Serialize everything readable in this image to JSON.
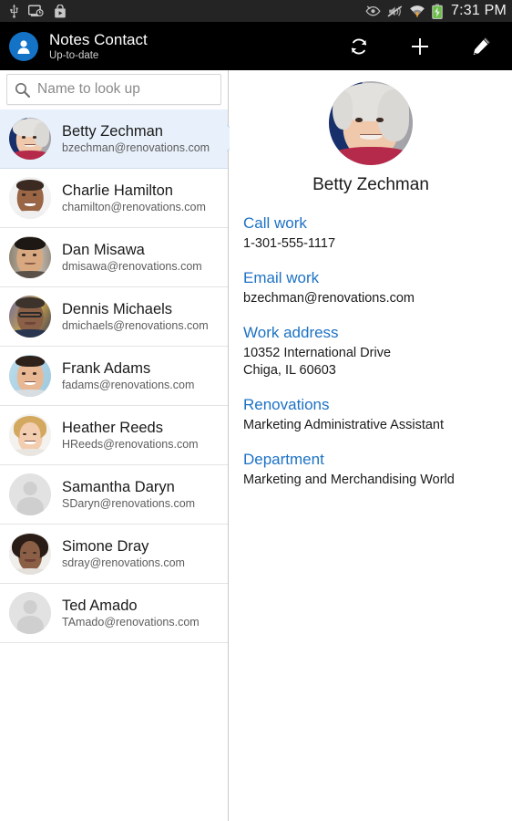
{
  "statusbar": {
    "icons": [
      "usb-icon",
      "screen-timeout-icon",
      "play-store-icon"
    ],
    "right_icons": [
      "eye-blocked-icon",
      "mute-vibrate-off-icon",
      "wifi-icon",
      "battery-charging-icon"
    ],
    "time": "7:31 PM"
  },
  "actionbar": {
    "app_icon": "person-icon",
    "title": "Notes Contact",
    "subtitle": "Up-to-date",
    "actions": [
      {
        "name": "refresh-button",
        "icon": "refresh-icon",
        "label": "Refresh"
      },
      {
        "name": "add-button",
        "icon": "plus-icon",
        "label": "Add"
      },
      {
        "name": "edit-button",
        "icon": "pencil-icon",
        "label": "Edit"
      }
    ]
  },
  "search": {
    "icon": "search-icon",
    "value": "",
    "placeholder": "Name to look up"
  },
  "contacts": [
    {
      "name": "Betty Zechman",
      "email": "bzechman@renovations.com",
      "selected": true,
      "avatar": "photo"
    },
    {
      "name": "Charlie Hamilton",
      "email": "chamilton@renovations.com",
      "selected": false,
      "avatar": "photo"
    },
    {
      "name": "Dan Misawa",
      "email": "dmisawa@renovations.com",
      "selected": false,
      "avatar": "photo"
    },
    {
      "name": "Dennis Michaels",
      "email": "dmichaels@renovations.com",
      "selected": false,
      "avatar": "photo"
    },
    {
      "name": "Frank Adams",
      "email": "fadams@renovations.com",
      "selected": false,
      "avatar": "photo"
    },
    {
      "name": "Heather Reeds",
      "email": "HReeds@renovations.com",
      "selected": false,
      "avatar": "photo"
    },
    {
      "name": "Samantha Daryn",
      "email": "SDaryn@renovations.com",
      "selected": false,
      "avatar": "placeholder"
    },
    {
      "name": "Simone Dray",
      "email": "sdray@renovations.com",
      "selected": false,
      "avatar": "photo"
    },
    {
      "name": "Ted Amado",
      "email": "TAmado@renovations.com",
      "selected": false,
      "avatar": "placeholder"
    }
  ],
  "detail": {
    "avatar": "photo",
    "name": "Betty Zechman",
    "fields": [
      {
        "label": "Call work",
        "value": "1-301-555-1117"
      },
      {
        "label": "Email work",
        "value": "bzechman@renovations.com"
      },
      {
        "label": "Work address",
        "value": "10352 International Drive\nChiga, IL 60603"
      },
      {
        "label": "Renovations",
        "value": "Marketing Administrative Assistant"
      },
      {
        "label": "Department",
        "value": "Marketing and Merchandising World"
      }
    ]
  },
  "colors": {
    "accent_link": "#1d72c4",
    "app_icon_blue": "#1473c6",
    "selected_row": "#e8f1fb",
    "actionbar_bg": "#000000",
    "statusbar_bg": "#242424",
    "battery_green": "#6ac045",
    "wifi_amber": "#e8a33d"
  }
}
